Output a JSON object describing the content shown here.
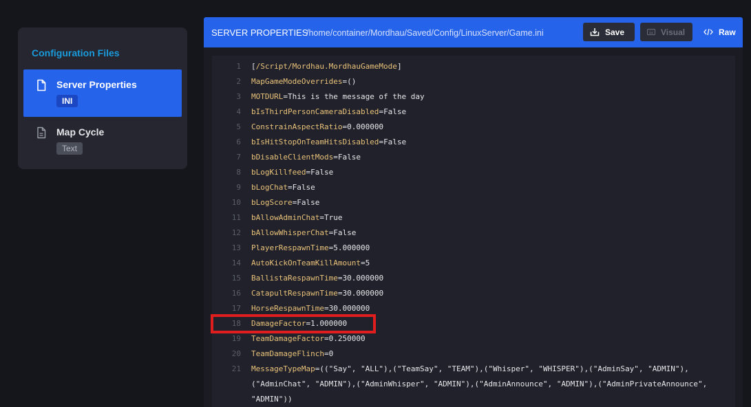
{
  "sidebar": {
    "title": "Configuration Files",
    "items": [
      {
        "name": "Server Properties",
        "badge": "INI",
        "active": true
      },
      {
        "name": "Map Cycle",
        "badge": "Text",
        "active": false
      }
    ]
  },
  "header": {
    "title": "SERVER PROPERTIES",
    "path": "/home/container/Mordhau/Saved/Config/LinuxServer/Game.ini",
    "save_label": "Save",
    "visual_label": "Visual",
    "raw_label": "Raw"
  },
  "editor": {
    "section": "/Script/Mordhau.MordhauGameMode",
    "lines": [
      {
        "n": "1",
        "type": "section"
      },
      {
        "n": "2",
        "key": "MapGameModeOverrides",
        "value": "()"
      },
      {
        "n": "3",
        "key": "MOTDURL",
        "value": "This is the message of the day"
      },
      {
        "n": "4",
        "key": "bIsThirdPersonCameraDisabled",
        "value": "False"
      },
      {
        "n": "5",
        "key": "ConstrainAspectRatio",
        "value": "0.000000"
      },
      {
        "n": "6",
        "key": "bIsHitStopOnTeamHitsDisabled",
        "value": "False"
      },
      {
        "n": "7",
        "key": "bDisableClientMods",
        "value": "False"
      },
      {
        "n": "8",
        "key": "bLogKillfeed",
        "value": "False"
      },
      {
        "n": "9",
        "key": "bLogChat",
        "value": "False"
      },
      {
        "n": "10",
        "key": "bLogScore",
        "value": "False"
      },
      {
        "n": "11",
        "key": "bAllowAdminChat",
        "value": "True"
      },
      {
        "n": "12",
        "key": "bAllowWhisperChat",
        "value": "False"
      },
      {
        "n": "13",
        "key": "PlayerRespawnTime",
        "value": "5.000000"
      },
      {
        "n": "14",
        "key": "AutoKickOnTeamKillAmount",
        "value": "5"
      },
      {
        "n": "15",
        "key": "BallistaRespawnTime",
        "value": "30.000000"
      },
      {
        "n": "16",
        "key": "CatapultRespawnTime",
        "value": "30.000000"
      },
      {
        "n": "17",
        "key": "HorseRespawnTime",
        "value": "30.000000"
      },
      {
        "n": "18",
        "key": "DamageFactor",
        "value": "1.000000"
      },
      {
        "n": "19",
        "key": "TeamDamageFactor",
        "value": "0.250000"
      },
      {
        "n": "20",
        "key": "TeamDamageFlinch",
        "value": "0"
      },
      {
        "n": "21",
        "key": "MessageTypeMap",
        "value": "((\"Say\", \"ALL\"),(\"TeamSay\", \"TEAM\"),(\"Whisper\", \"WHISPER\"),(\"AdminSay\", \"ADMIN\"),"
      },
      {
        "n": "",
        "key": "",
        "value": "(\"AdminChat\", \"ADMIN\"),(\"AdminWhisper\", \"ADMIN\"),(\"AdminAnnounce\", \"ADMIN\"),(\"AdminPrivateAnnounce\","
      },
      {
        "n": "",
        "key": "",
        "value": "\"ADMIN\"))"
      }
    ]
  },
  "colors": {
    "accent": "#2563eb",
    "key": "#e9c27a",
    "highlight": "#e01e1e"
  }
}
